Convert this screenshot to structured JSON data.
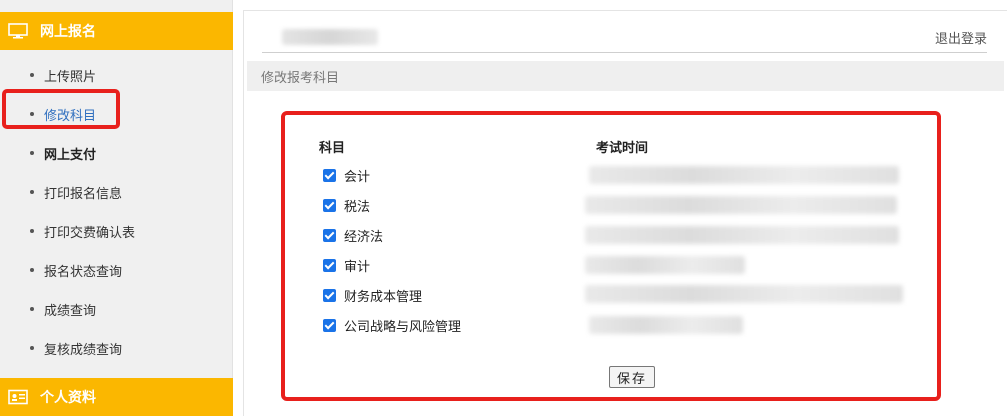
{
  "sidebar": {
    "section1_title": "网上报名",
    "items": [
      {
        "label": "上传照片"
      },
      {
        "label": "修改科目"
      },
      {
        "label": "网上支付"
      },
      {
        "label": "打印报名信息"
      },
      {
        "label": "打印交费确认表"
      },
      {
        "label": "报名状态查询"
      },
      {
        "label": "成绩查询"
      },
      {
        "label": "复核成绩查询"
      }
    ],
    "section2_title": "个人资料"
  },
  "header": {
    "logout": "退出登录"
  },
  "page": {
    "subtitle": "修改报考科目"
  },
  "form": {
    "col_subject": "科目",
    "col_time": "考试时间",
    "subjects": [
      {
        "name": "会计",
        "checked": true
      },
      {
        "name": "税法",
        "checked": true
      },
      {
        "name": "经济法",
        "checked": true
      },
      {
        "name": "审计",
        "checked": true
      },
      {
        "name": "财务成本管理",
        "checked": true
      },
      {
        "name": "公司战略与风险管理",
        "checked": true
      }
    ],
    "save_label": "保存"
  },
  "colors": {
    "accent": "#fbb700",
    "highlight": "#e8201c",
    "active_link": "#2f6fbf",
    "checkbox": "#1a73e8"
  }
}
